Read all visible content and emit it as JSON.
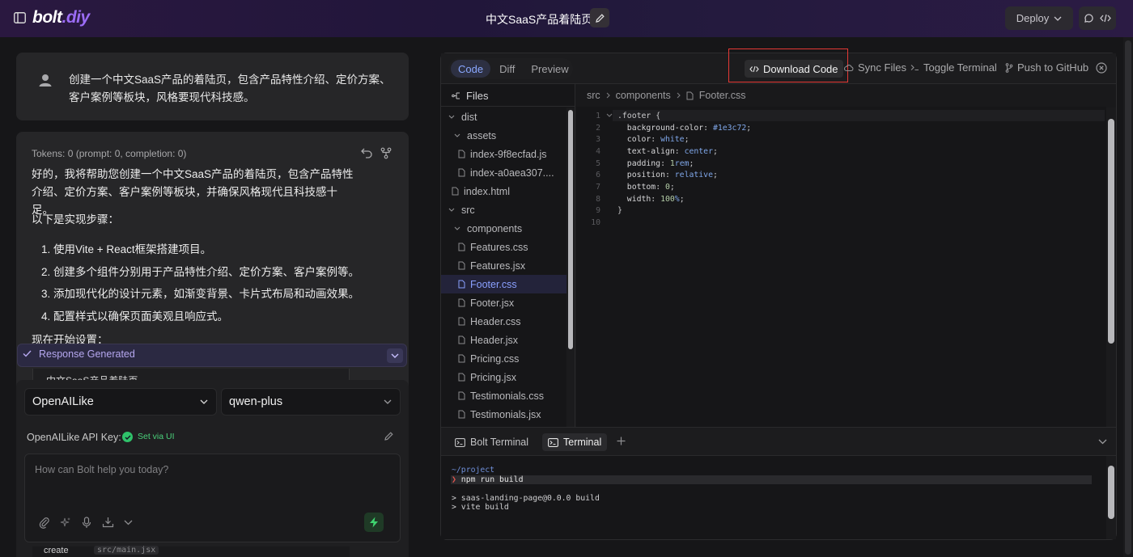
{
  "header": {
    "logo_main": "bolt",
    "logo_accent": ".diy",
    "project_title": "中文SaaS产品着陆页",
    "deploy_label": "Deploy"
  },
  "chat": {
    "user_message": "创建一个中文SaaS产品的着陆页，包含产品特性介绍、定价方案、客户案例等板块，风格要现代科技感。",
    "tokens": "Tokens: 0 (prompt: 0, completion: 0)",
    "reply_intro": "好的，我将帮助您创建一个中文SaaS产品的着陆页，包含产品特性介绍、定价方案、客户案例等板块，并确保风格现代且科技感十足。",
    "steps_heading": "以下是实现步骤：",
    "steps": [
      "1. 使用Vite + React框架搭建项目。",
      "2. 创建多个组件分别用于产品特性介绍、定价方案、客户案例等。",
      "3. 添加现代化的设计元素，如渐变背景、卡片式布局和动画效果。",
      "4. 配置样式以确保页面美观且响应式。"
    ],
    "truncated_line": "现在开始设置：",
    "response_status": "Response Generated",
    "peek_text": "中文SaaS产品着陆页",
    "under_text": "create",
    "under_path": "src/main.jsx"
  },
  "composer": {
    "provider": "OpenAILike",
    "model": "qwen-plus",
    "api_key_label": "OpenAILike API Key:",
    "api_key_status": "Set via UI",
    "placeholder": "How can Bolt help you today?"
  },
  "workbench": {
    "tabs": [
      "Code",
      "Diff",
      "Preview"
    ],
    "active_tab": "Code",
    "actions": {
      "download": "Download Code",
      "sync": "Sync Files",
      "toggle_terminal": "Toggle Terminal",
      "push": "Push to GitHub"
    },
    "files_label": "Files",
    "breadcrumb": [
      "src",
      "components",
      "Footer.css"
    ],
    "tree": [
      {
        "name": "dist",
        "kind": "folder",
        "depth": 0
      },
      {
        "name": "assets",
        "kind": "folder",
        "depth": 1
      },
      {
        "name": "index-9f8ecfad.js",
        "kind": "file",
        "depth": 2
      },
      {
        "name": "index-a0aea307....",
        "kind": "file",
        "depth": 2
      },
      {
        "name": "index.html",
        "kind": "file",
        "depth": 1
      },
      {
        "name": "src",
        "kind": "folder",
        "depth": 0
      },
      {
        "name": "components",
        "kind": "folder",
        "depth": 1
      },
      {
        "name": "Features.css",
        "kind": "file",
        "depth": 2
      },
      {
        "name": "Features.jsx",
        "kind": "file",
        "depth": 2
      },
      {
        "name": "Footer.css",
        "kind": "file",
        "depth": 2,
        "selected": true
      },
      {
        "name": "Footer.jsx",
        "kind": "file",
        "depth": 2
      },
      {
        "name": "Header.css",
        "kind": "file",
        "depth": 2
      },
      {
        "name": "Header.jsx",
        "kind": "file",
        "depth": 2
      },
      {
        "name": "Pricing.css",
        "kind": "file",
        "depth": 2
      },
      {
        "name": "Pricing.jsx",
        "kind": "file",
        "depth": 2
      },
      {
        "name": "Testimonials.css",
        "kind": "file",
        "depth": 2
      },
      {
        "name": "Testimonials.jsx",
        "kind": "file",
        "depth": 2
      }
    ],
    "code": [
      [
        {
          "t": ".footer",
          "c": "sel"
        },
        {
          "t": " {",
          "c": "p"
        }
      ],
      [
        {
          "t": "  background-color",
          "c": "prop"
        },
        {
          "t": ": ",
          "c": "p"
        },
        {
          "t": "#1e3c72",
          "c": "val"
        },
        {
          "t": ";",
          "c": "p"
        }
      ],
      [
        {
          "t": "  color",
          "c": "prop"
        },
        {
          "t": ": ",
          "c": "p"
        },
        {
          "t": "white",
          "c": "val"
        },
        {
          "t": ";",
          "c": "p"
        }
      ],
      [
        {
          "t": "  text-align",
          "c": "prop"
        },
        {
          "t": ": ",
          "c": "p"
        },
        {
          "t": "center",
          "c": "val"
        },
        {
          "t": ";",
          "c": "p"
        }
      ],
      [
        {
          "t": "  padding",
          "c": "prop"
        },
        {
          "t": ": ",
          "c": "p"
        },
        {
          "t": "1",
          "c": "num"
        },
        {
          "t": "rem",
          "c": "val"
        },
        {
          "t": ";",
          "c": "p"
        }
      ],
      [
        {
          "t": "  position",
          "c": "prop"
        },
        {
          "t": ": ",
          "c": "p"
        },
        {
          "t": "relative",
          "c": "val"
        },
        {
          "t": ";",
          "c": "p"
        }
      ],
      [
        {
          "t": "  bottom",
          "c": "prop"
        },
        {
          "t": ": ",
          "c": "p"
        },
        {
          "t": "0",
          "c": "num"
        },
        {
          "t": ";",
          "c": "p"
        }
      ],
      [
        {
          "t": "  width",
          "c": "prop"
        },
        {
          "t": ": ",
          "c": "p"
        },
        {
          "t": "100",
          "c": "num"
        },
        {
          "t": "%",
          "c": "val"
        },
        {
          "t": ";",
          "c": "p"
        }
      ],
      [
        {
          "t": "}",
          "c": "p"
        }
      ],
      []
    ],
    "terminal_tabs": [
      "Bolt Terminal",
      "Terminal"
    ],
    "terminal_lines": [
      {
        "text": "~/project",
        "c": "path"
      },
      {
        "text": "❯ npm run build",
        "c": "cmd"
      },
      {
        "text": "",
        "c": "out"
      },
      {
        "text": "> saas-landing-page@0.0.0 build",
        "c": "out"
      },
      {
        "text": "> vite build",
        "c": "out"
      }
    ]
  },
  "colors": {
    "accent": "#9b6cf5",
    "selector": "#c9c9cb",
    "property": "#d6d6d8",
    "value": "#7fa6e8",
    "number": "#b5cea8"
  }
}
